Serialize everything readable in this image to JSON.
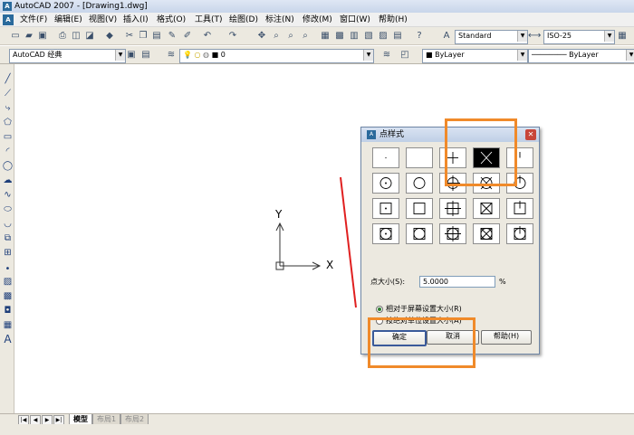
{
  "window": {
    "title": "AutoCAD 2007 - [Drawing1.dwg]",
    "app_logo": "A"
  },
  "menu": {
    "items": [
      "文件(F)",
      "编辑(E)",
      "视图(V)",
      "插入(I)",
      "格式(O)",
      "工具(T)",
      "绘图(D)",
      "标注(N)",
      "修改(M)",
      "窗口(W)",
      "帮助(H)"
    ]
  },
  "toolbar": {
    "text_style": "Standard",
    "dim_style": "ISO-25"
  },
  "properties_bar": {
    "workspace": "AutoCAD 经典",
    "layer": "0",
    "color": "ByLayer",
    "linetype": "ByLayer"
  },
  "canvas": {
    "ucs_x_label": "X",
    "ucs_y_label": "Y",
    "annotation_color": "#e02020"
  },
  "layout_tabs": {
    "model": "模型",
    "layout1": "布局1",
    "layout2": "布局2"
  },
  "dialog": {
    "title": "点样式",
    "point_styles_selected_index": 3,
    "point_size_label": "点大小(S):",
    "point_size_value": "5.0000",
    "point_size_unit": "%",
    "radio_relative": "相对于屏幕设置大小(R)",
    "radio_absolute": "按绝对单位设置大小(A)",
    "relative_selected": true,
    "ok_label": "确定",
    "cancel_label": "取消",
    "help_label": "帮助(H)"
  },
  "colors": {
    "highlight": "#f08a2a",
    "dialog_bg": "#ece9e0",
    "title_bar": "#c8d5ea"
  }
}
